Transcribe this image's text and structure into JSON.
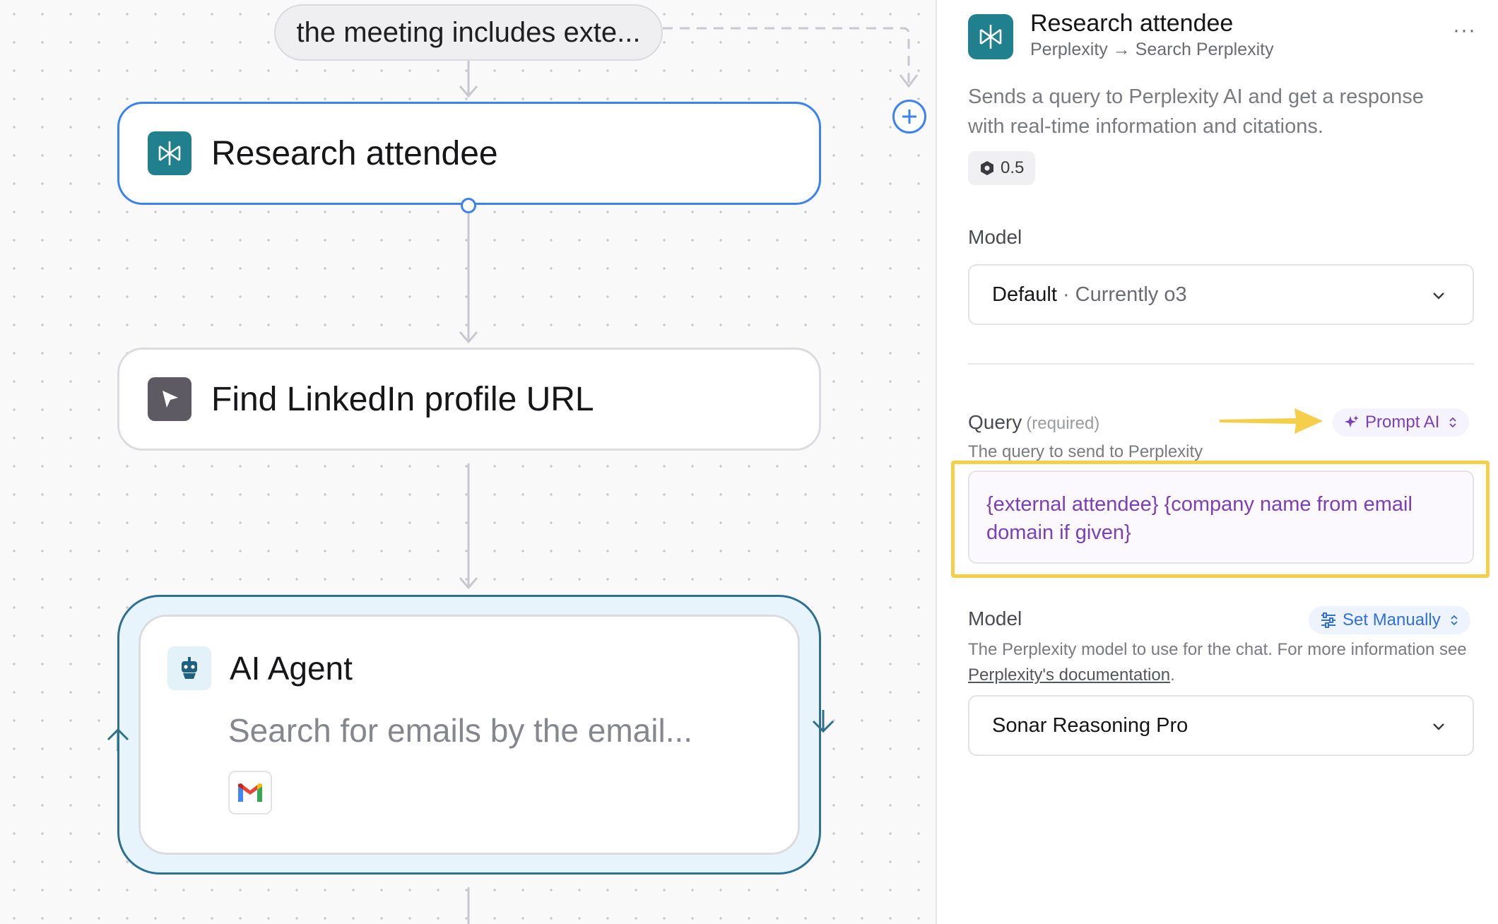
{
  "canvas": {
    "condition_pill": "the meeting includes exte...",
    "nodes": {
      "research": {
        "title": "Research attendee",
        "icon": "perplexity-icon"
      },
      "linkedin": {
        "title": "Find LinkedIn profile URL",
        "icon": "cursor-arrow-icon"
      },
      "agent": {
        "title": "AI Agent",
        "description": "Search for emails by the email...",
        "icon": "robot-icon",
        "tool_icon": "gmail-icon"
      }
    }
  },
  "panel": {
    "title": "Research attendee",
    "subtitle": "Perplexity → Search Perplexity",
    "more_label": "···",
    "description": "Sends a query to Perplexity AI and get a response with real-time information and citations.",
    "cost_badge": "0.5",
    "model_section": {
      "label": "Model",
      "selected_default": "Default",
      "selected_current": " · Currently o3"
    },
    "query": {
      "label": "Query",
      "required": "(required)",
      "mode_chip": "Prompt AI",
      "hint": "The query to send to Perplexity",
      "value": "{external attendee} {company name from email domain if given}"
    },
    "perplexity_model": {
      "label": "Model",
      "mode_chip": "Set Manually",
      "hint_prefix": "The Perplexity model to use for the chat. For more information see ",
      "hint_link": "Perplexity's documentation",
      "hint_suffix": ".",
      "selected": "Sonar Reasoning Pro"
    }
  },
  "colors": {
    "accent_blue": "#3b82f6",
    "agent_border": "#2f6f8f",
    "highlight_yellow": "#f6cf4a",
    "prompt_purple": "#7b3fb8",
    "perplexity_teal": "#20808d"
  }
}
